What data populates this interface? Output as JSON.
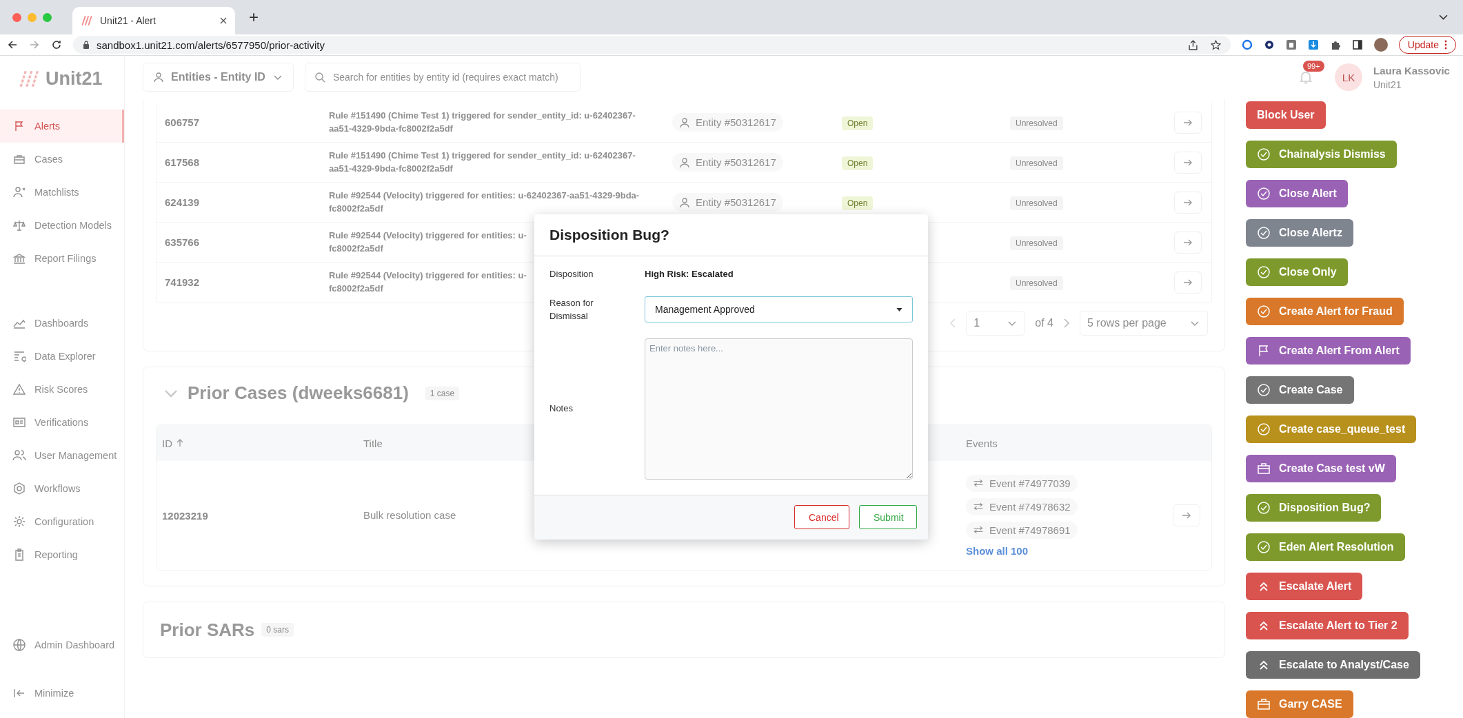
{
  "browser": {
    "tab_title": "Unit21 - Alert",
    "url": "sandbox1.unit21.com/alerts/6577950/prior-activity",
    "update_button": "Update"
  },
  "header": {
    "logo": "Unit21",
    "entity_select": "Entities - Entity ID",
    "search": {
      "placeholder": "Search for entities by entity id (requires exact match)"
    },
    "notifications_badge": "99+",
    "user": {
      "initials": "LK",
      "name": "Laura Kassovic",
      "org": "Unit21"
    }
  },
  "sidebar": {
    "sections": [
      {
        "items": [
          {
            "label": "Alerts",
            "selected": true
          },
          {
            "label": "Cases",
            "selected": false
          },
          {
            "label": "Matchlists",
            "selected": false
          },
          {
            "label": "Detection Models",
            "selected": false
          },
          {
            "label": "Report Filings",
            "selected": false
          }
        ]
      },
      {
        "items": [
          {
            "label": "Dashboards",
            "selected": false
          },
          {
            "label": "Data Explorer",
            "selected": false
          },
          {
            "label": "Risk Scores",
            "selected": false
          },
          {
            "label": "Verifications",
            "selected": false
          },
          {
            "label": "User Management",
            "selected": false
          },
          {
            "label": "Workflows",
            "selected": false
          },
          {
            "label": "Configuration",
            "selected": false
          },
          {
            "label": "Reporting",
            "selected": false
          }
        ]
      },
      {
        "items": [
          {
            "label": "Admin Dashboard",
            "selected": false
          }
        ]
      }
    ],
    "minimize": "Minimize"
  },
  "alerts_table": {
    "rows": [
      {
        "id": "606757",
        "description": "Rule #151490 (Chime Test 1) triggered for sender_entity_id: u-62402367-\naa51-4329-9bda-fc8002f2a5df",
        "entity": "Entity #50312617",
        "status": "Open",
        "resolution": "Unresolved"
      },
      {
        "id": "617568",
        "description": "Rule #151490 (Chime Test 1) triggered for sender_entity_id: u-62402367-\naa51-4329-9bda-fc8002f2a5df",
        "entity": "Entity #50312617",
        "status": "Open",
        "resolution": "Unresolved"
      },
      {
        "id": "624139",
        "description": "Rule #92544 (Velocity) triggered for entities: u-62402367-aa51-4329-9bda-\nfc8002f2a5df",
        "entity": "Entity #50312617",
        "status": "Open",
        "resolution": "Unresolved"
      },
      {
        "id": "635766",
        "description": "Rule #92544 (Velocity) triggered for entities: u-\nfc8002f2a5df",
        "resolution": "Unresolved"
      },
      {
        "id": "741932",
        "description": "Rule #92544 (Velocity) triggered for entities: u-\nfc8002f2a5df",
        "resolution": "Unresolved"
      }
    ],
    "pagination": {
      "page": "1",
      "of": "of 4",
      "rows_per_page": "5 rows per page"
    }
  },
  "prior_cases": {
    "title": "Prior Cases (dweeks6681)",
    "count": "1 case",
    "expanded": true,
    "columns": [
      "ID",
      "Title",
      "Events"
    ],
    "rows": [
      {
        "id": "12023219",
        "title": "Bulk resolution case",
        "events": [
          "Event #74977039",
          "Event #74978632",
          "Event #74978691"
        ],
        "show_all": "Show all 100"
      }
    ]
  },
  "prior_sars": {
    "title": "Prior SARs",
    "count": "0 sars"
  },
  "actions": [
    {
      "label": "Block User",
      "kind": "plain",
      "color": "#d9534f"
    },
    {
      "label": "Chainalysis Dismiss",
      "kind": "check",
      "color": "#7e9a2c"
    },
    {
      "label": "Close Alert",
      "kind": "check",
      "color": "#9a62b5"
    },
    {
      "label": "Close Alertz",
      "kind": "check",
      "color": "#7f858f"
    },
    {
      "label": "Close Only",
      "kind": "check",
      "color": "#7e9a2c"
    },
    {
      "label": "Create Alert for Fraud",
      "kind": "check",
      "color": "#d9782a"
    },
    {
      "label": "Create Alert From Alert",
      "kind": "flag",
      "color": "#9a62b5"
    },
    {
      "label": "Create Case",
      "kind": "check",
      "color": "#757575"
    },
    {
      "label": "Create case_queue_test",
      "kind": "check",
      "color": "#b8901c"
    },
    {
      "label": "Create Case test vW",
      "kind": "briefcase",
      "color": "#9a62b5"
    },
    {
      "label": "Disposition Bug?",
      "kind": "check",
      "color": "#7e9a2c"
    },
    {
      "label": "Eden Alert Resolution",
      "kind": "check",
      "color": "#7e9a2c"
    },
    {
      "label": "Escalate Alert",
      "kind": "chevrons",
      "color": "#d9534f"
    },
    {
      "label": "Escalate Alert to Tier 2",
      "kind": "chevrons",
      "color": "#d9534f"
    },
    {
      "label": "Escalate to Analyst/Case",
      "kind": "chevrons",
      "color": "#6e6e6e"
    },
    {
      "label": "Garry CASE",
      "kind": "briefcase",
      "color": "#d9782a"
    }
  ],
  "dialog": {
    "title": "Disposition Bug?",
    "disposition_label": "Disposition",
    "disposition_value": "High Risk: Escalated",
    "reason_label": "Reason for Dismissal",
    "reason_value": "Management Approved",
    "notes_label": "Notes",
    "notes": {
      "placeholder": "Enter notes here..."
    },
    "cancel": "Cancel",
    "submit": "Submit"
  }
}
